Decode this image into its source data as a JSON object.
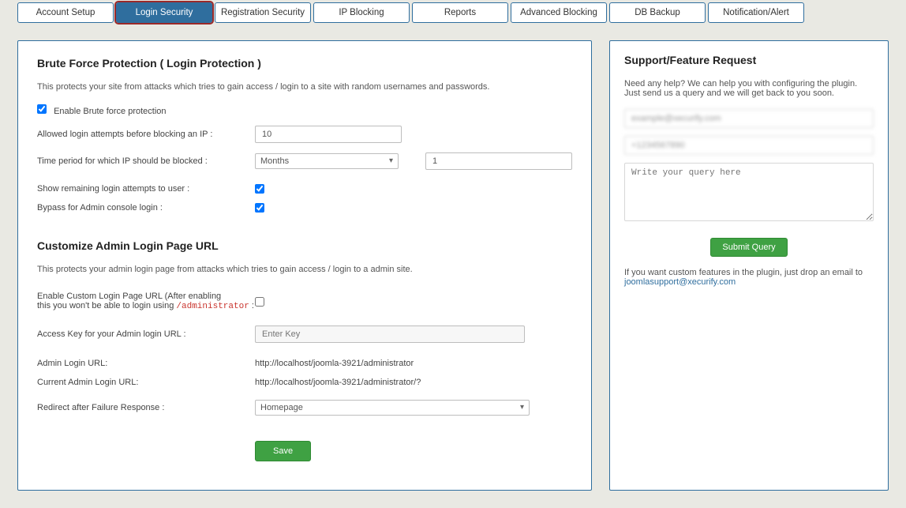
{
  "tabs": [
    {
      "label": "Account Setup"
    },
    {
      "label": "Login Security"
    },
    {
      "label": "Registration Security"
    },
    {
      "label": "IP Blocking"
    },
    {
      "label": "Reports"
    },
    {
      "label": "Advanced Blocking"
    },
    {
      "label": "DB Backup"
    },
    {
      "label": "Notification/Alert"
    }
  ],
  "activeTab": 1,
  "main": {
    "section1": {
      "title": "Brute Force Protection ( Login Protection )",
      "desc": "This protects your site from attacks which tries to gain access / login to a site with random usernames and passwords.",
      "enable_label": "Enable Brute force protection",
      "attempts_label": "Allowed login attempts before blocking an IP :",
      "attempts_value": "10",
      "period_label": "Time period for which IP should be blocked :",
      "period_unit": "Months",
      "period_value": "1",
      "show_remaining_label": "Show remaining login attempts to user :",
      "bypass_label": "Bypass for Admin console login :"
    },
    "section2": {
      "title": "Customize Admin Login Page URL",
      "desc": "This protects your admin login page from attacks which tries to gain access / login to a admin site.",
      "enable_custom_label_a": "Enable Custom Login Page URL (After enabling",
      "enable_custom_label_b": "this you won't be able to login using ",
      "enable_custom_code": "/administrator",
      "access_key_label": "Access Key for your Admin login URL :",
      "access_key_placeholder": "Enter Key",
      "admin_url_label": "Admin Login URL:",
      "admin_url_value": "http://localhost/joomla-3921/administrator",
      "current_url_label": "Current Admin Login URL:",
      "current_url_value": "http://localhost/joomla-3921/administrator/?",
      "redirect_label": "Redirect after Failure Response :",
      "redirect_value": "Homepage"
    },
    "save_label": "Save"
  },
  "side": {
    "title": "Support/Feature Request",
    "desc": "Need any help? We can help you with configuring the plugin. Just send us a query and we will get back to you soon.",
    "email_value": "example@xecurify.com",
    "phone_value": "+1234567890",
    "query_placeholder": "Write your query here",
    "submit_label": "Submit Query",
    "note_a": "If you want custom features in the plugin, just drop an email to ",
    "note_link": "joomlasupport@xecurify.com"
  }
}
